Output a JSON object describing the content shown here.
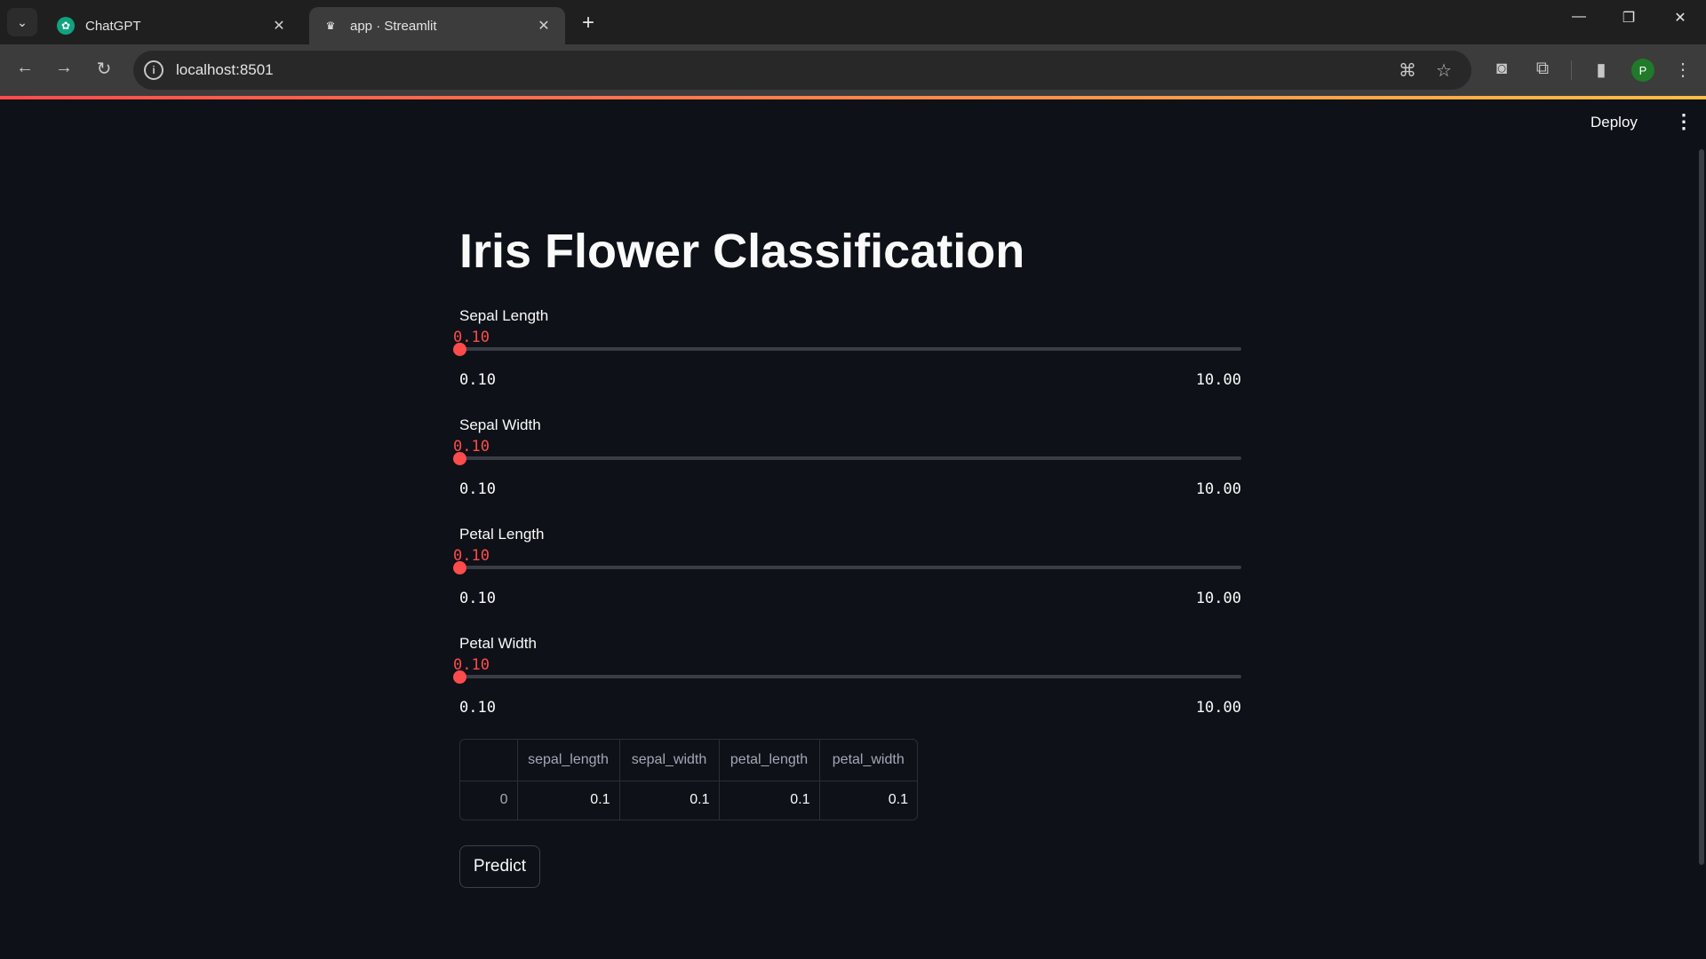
{
  "browser": {
    "tabs": [
      {
        "title": "ChatGPT",
        "active": false
      },
      {
        "title": "app · Streamlit",
        "active": true
      }
    ],
    "url": "localhost:8501",
    "profile_initial": "P"
  },
  "app": {
    "deploy_label": "Deploy",
    "title": "Iris Flower Classification",
    "sliders": [
      {
        "label": "Sepal Length",
        "value": "0.10",
        "min": "0.10",
        "max": "10.00",
        "fraction": 0
      },
      {
        "label": "Sepal Width",
        "value": "0.10",
        "min": "0.10",
        "max": "10.00",
        "fraction": 0
      },
      {
        "label": "Petal Length",
        "value": "0.10",
        "min": "0.10",
        "max": "10.00",
        "fraction": 0
      },
      {
        "label": "Petal Width",
        "value": "0.10",
        "min": "0.10",
        "max": "10.00",
        "fraction": 0
      }
    ],
    "table": {
      "columns": [
        "",
        "sepal_length",
        "sepal_width",
        "petal_length",
        "petal_width"
      ],
      "rows": [
        [
          "0",
          "0.1",
          "0.1",
          "0.1",
          "0.1"
        ]
      ]
    },
    "predict_label": "Predict"
  },
  "colors": {
    "accent": "#ff4b4b",
    "background": "#0e1117"
  }
}
